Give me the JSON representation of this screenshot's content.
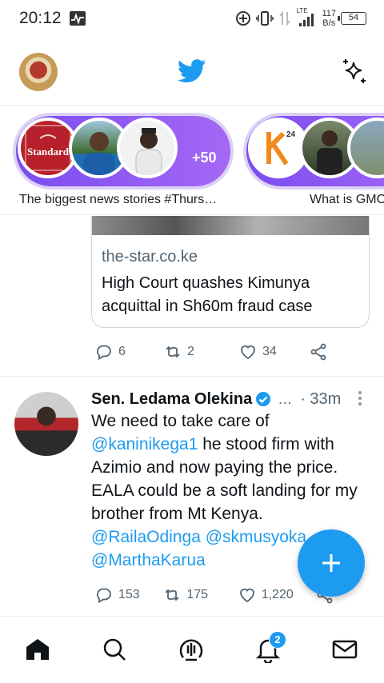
{
  "status_bar": {
    "time": "20:12",
    "network_type": "LTE",
    "speed_value": "117",
    "speed_unit": "B/s",
    "battery": "54"
  },
  "header": {
    "logo_icon": "twitter-bird-icon",
    "sparkle_icon": "sparkle-icon",
    "accent_color": "#1d9bf0"
  },
  "fleets": [
    {
      "caption": "The biggest news stories #Thurs…",
      "extra_count": "+50",
      "logo_text": "Standard"
    },
    {
      "caption": "What is GMO",
      "logo_text": "K24"
    }
  ],
  "tweet1": {
    "card_domain": "the-star.co.ke",
    "card_title": "High Court quashes Kimunya acquittal in Sh60m fraud case",
    "replies": "6",
    "retweets": "2",
    "likes": "34"
  },
  "tweet2": {
    "author": "Sen. Ledama Olekina",
    "ellipsis": "…",
    "time": "· 33m",
    "text_1": "We need to take care of",
    "mention_1": "@kaninikega1",
    "text_2": " he stood firm with Azimio and now paying the price. EALA could be a soft landing for my brother from Mt Kenya.",
    "mention_2": "@RailaOdinga",
    "mention_3": "@skmusyoka",
    "mention_4": "@MarthaKarua",
    "replies": "153",
    "retweets": "175",
    "likes": "1,220"
  },
  "bottom_nav": {
    "items": [
      "home-icon",
      "search-icon",
      "spaces-icon",
      "notifications-icon",
      "messages-icon"
    ],
    "notification_count": "2"
  }
}
